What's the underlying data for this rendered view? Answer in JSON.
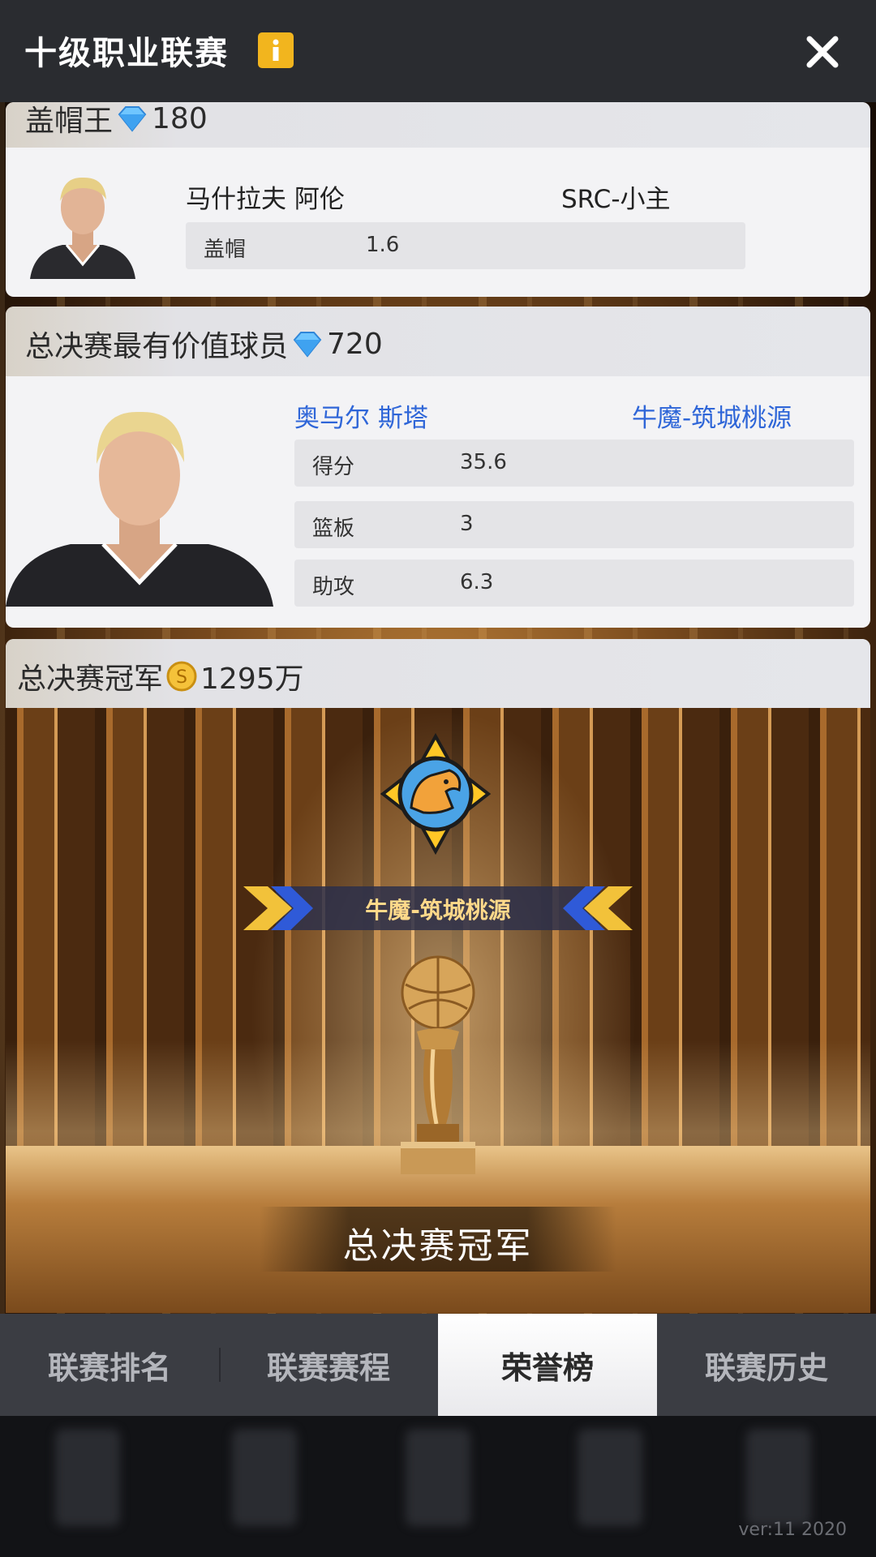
{
  "header": {
    "title": "十级职业联赛",
    "info_icon": "info-icon",
    "close_icon": "close-icon"
  },
  "block_king": {
    "heading": "盖帽王",
    "reward_icon": "diamond-icon",
    "reward": "180",
    "player_name": "马什拉夫 阿伦",
    "team": "SRC-小主",
    "stats": [
      {
        "label": "盖帽",
        "value": "1.6"
      }
    ]
  },
  "finals_mvp": {
    "heading": "总决赛最有价值球员",
    "reward_icon": "diamond-icon",
    "reward": "720",
    "player_name": "奥马尔 斯塔",
    "team": "牛魔-筑城桃源",
    "stats": [
      {
        "label": "得分",
        "value": "35.6"
      },
      {
        "label": "篮板",
        "value": "3"
      },
      {
        "label": "助攻",
        "value": "6.3"
      }
    ]
  },
  "champion": {
    "heading": "总决赛冠军",
    "reward_icon": "coin-icon",
    "reward": "1295万",
    "team": "牛魔-筑城桃源",
    "trophy_label": "总决赛冠军"
  },
  "tabs": [
    {
      "label": "联赛排名",
      "active": false
    },
    {
      "label": "联赛赛程",
      "active": false
    },
    {
      "label": "荣誉榜",
      "active": true
    },
    {
      "label": "联赛历史",
      "active": false
    }
  ],
  "footer": {
    "version": "ver:11  2020"
  },
  "colors": {
    "header_bg": "#2a2c30",
    "accent_yellow": "#f2b51e",
    "link_blue": "#2f66d8",
    "tab_bar": "#3b3d43"
  }
}
